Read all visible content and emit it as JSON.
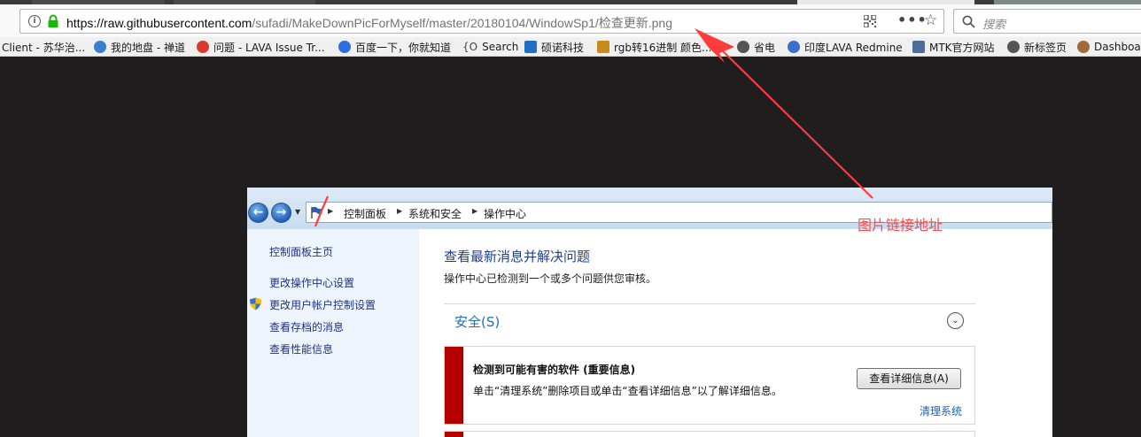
{
  "browser": {
    "url_host": "https://raw.githubusercontent.com",
    "url_path": "/sufadi/MakeDownPicForMyself/master/20180104/WindowSp1/",
    "url_file": "检查更新.png",
    "search_placeholder": "搜索",
    "more_glyph": "•••",
    "star_glyph": "☆"
  },
  "bookmarks": [
    {
      "label": "Client - 苏华治...",
      "color": "#777777"
    },
    {
      "label": "我的地盘 - 禅道",
      "color": "#3b7ed0"
    },
    {
      "label": "问题 - LAVA Issue Tr...",
      "color": "#d83a2b"
    },
    {
      "label": "百度一下，你就知道",
      "color": "#2f6ee0"
    },
    {
      "label": "Search",
      "color": "#444444"
    },
    {
      "label": "硕诺科技",
      "color": "#1f6fc5"
    },
    {
      "label": "rgb转16进制 颜色...",
      "color": "#c98a1b"
    },
    {
      "label": "省电",
      "color": "#555555"
    },
    {
      "label": "印度LAVA Redmine",
      "color": "#3a6fd0"
    },
    {
      "label": "MTK官方网站",
      "color": "#4a6f9a"
    },
    {
      "label": "新标签页",
      "color": "#555555"
    },
    {
      "label": "Dashboa",
      "color": "#a06a3a"
    }
  ],
  "annotation": {
    "label": "图片链接地址",
    "color": "#ff4a4a"
  },
  "window": {
    "breadcrumbs": [
      "控制面板",
      "系统和安全",
      "操作中心"
    ],
    "sidebar": [
      "控制面板主页",
      "更改操作中心设置",
      "更改用户帐户控制设置",
      "查看存档的消息",
      "查看性能信息"
    ],
    "main": {
      "title": "查看最新消息并解决问题",
      "subtitle": "操作中心已检测到一个或多个问题供您审核。",
      "section_title": "安全(S)",
      "alert": {
        "title": "检测到可能有害的软件 (重要信息)",
        "description": "单击“清理系统”删除项目或单击“查看详细信息”以了解详细信息。",
        "button": "查看详细信息(A)",
        "link": "清理系统"
      }
    }
  }
}
